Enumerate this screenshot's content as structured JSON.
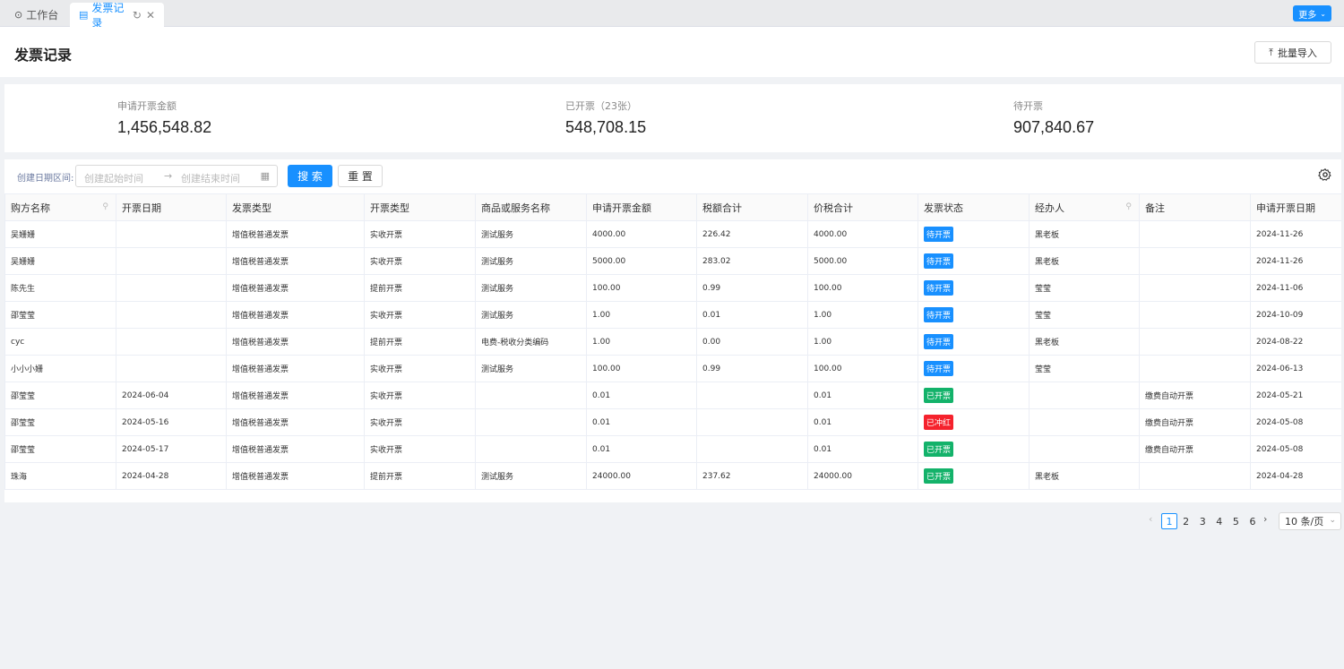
{
  "tabs": [
    {
      "label": "工作台",
      "icon": "dashboard-icon"
    },
    {
      "label": "发票记录",
      "icon": "document-icon",
      "active": true
    }
  ],
  "more_label": "更多",
  "page_title": "发票记录",
  "import_label": "批量导入",
  "stats": [
    {
      "label": "申请开票金额",
      "value": "1,456,548.82"
    },
    {
      "label": "已开票（23张）",
      "value": "548,708.15"
    },
    {
      "label": "待开票",
      "value": "907,840.67"
    }
  ],
  "filter": {
    "label": "创建日期区间:",
    "start_placeholder": "创建起始时间",
    "end_placeholder": "创建结束时间",
    "search_label": "搜 索",
    "reset_label": "重 置"
  },
  "columns": [
    "购方名称",
    "开票日期",
    "发票类型",
    "开票类型",
    "商品或服务名称",
    "申请开票金额",
    "税额合计",
    "价税合计",
    "发票状态",
    "经办人",
    "备注",
    "申请开票日期"
  ],
  "rows": [
    {
      "buyer": "吴姗姗",
      "date": "",
      "inv_type": "增值税普通发票",
      "issue_type": "实收开票",
      "goods": "测试服务",
      "amount": "4000.00",
      "tax": "226.42",
      "total": "4000.00",
      "status": "待开票",
      "handler": "黑老板",
      "note": "",
      "apply_date": "2024-11-26"
    },
    {
      "buyer": "吴姗姗",
      "date": "",
      "inv_type": "增值税普通发票",
      "issue_type": "实收开票",
      "goods": "测试服务",
      "amount": "5000.00",
      "tax": "283.02",
      "total": "5000.00",
      "status": "待开票",
      "handler": "黑老板",
      "note": "",
      "apply_date": "2024-11-26"
    },
    {
      "buyer": "陈先生",
      "date": "",
      "inv_type": "增值税普通发票",
      "issue_type": "提前开票",
      "goods": "测试服务",
      "amount": "100.00",
      "tax": "0.99",
      "total": "100.00",
      "status": "待开票",
      "handler": "莹莹",
      "note": "",
      "apply_date": "2024-11-06"
    },
    {
      "buyer": "邵莹莹",
      "date": "",
      "inv_type": "增值税普通发票",
      "issue_type": "实收开票",
      "goods": "测试服务",
      "amount": "1.00",
      "tax": "0.01",
      "total": "1.00",
      "status": "待开票",
      "handler": "莹莹",
      "note": "",
      "apply_date": "2024-10-09"
    },
    {
      "buyer": "cyc",
      "date": "",
      "inv_type": "增值税普通发票",
      "issue_type": "提前开票",
      "goods": "电费-税收分类编码",
      "amount": "1.00",
      "tax": "0.00",
      "total": "1.00",
      "status": "待开票",
      "handler": "黑老板",
      "note": "",
      "apply_date": "2024-08-22"
    },
    {
      "buyer": "小小小姗",
      "date": "",
      "inv_type": "增值税普通发票",
      "issue_type": "实收开票",
      "goods": "测试服务",
      "amount": "100.00",
      "tax": "0.99",
      "total": "100.00",
      "status": "待开票",
      "handler": "莹莹",
      "note": "",
      "apply_date": "2024-06-13"
    },
    {
      "buyer": "邵莹莹",
      "date": "2024-06-04",
      "inv_type": "增值税普通发票",
      "issue_type": "实收开票",
      "goods": "",
      "amount": "0.01",
      "tax": "",
      "total": "0.01",
      "status": "已开票",
      "handler": "",
      "note": "缴费自动开票",
      "apply_date": "2024-05-21"
    },
    {
      "buyer": "邵莹莹",
      "date": "2024-05-16",
      "inv_type": "增值税普通发票",
      "issue_type": "实收开票",
      "goods": "",
      "amount": "0.01",
      "tax": "",
      "total": "0.01",
      "status": "已冲红",
      "handler": "",
      "note": "缴费自动开票",
      "apply_date": "2024-05-08"
    },
    {
      "buyer": "邵莹莹",
      "date": "2024-05-17",
      "inv_type": "增值税普通发票",
      "issue_type": "实收开票",
      "goods": "",
      "amount": "0.01",
      "tax": "",
      "total": "0.01",
      "status": "已开票",
      "handler": "",
      "note": "缴费自动开票",
      "apply_date": "2024-05-08"
    },
    {
      "buyer": "珠海",
      "date": "2024-04-28",
      "inv_type": "增值税普通发票",
      "issue_type": "提前开票",
      "goods": "测试服务",
      "amount": "24000.00",
      "tax": "237.62",
      "total": "24000.00",
      "status": "已开票",
      "handler": "黑老板",
      "note": "",
      "apply_date": "2024-04-28"
    }
  ],
  "pagination": {
    "pages": [
      "1",
      "2",
      "3",
      "4",
      "5",
      "6"
    ],
    "current": "1",
    "page_size": "10 条/页"
  },
  "colors": {
    "primary": "#1890ff",
    "success": "#13b26a",
    "danger": "#f5222d"
  }
}
